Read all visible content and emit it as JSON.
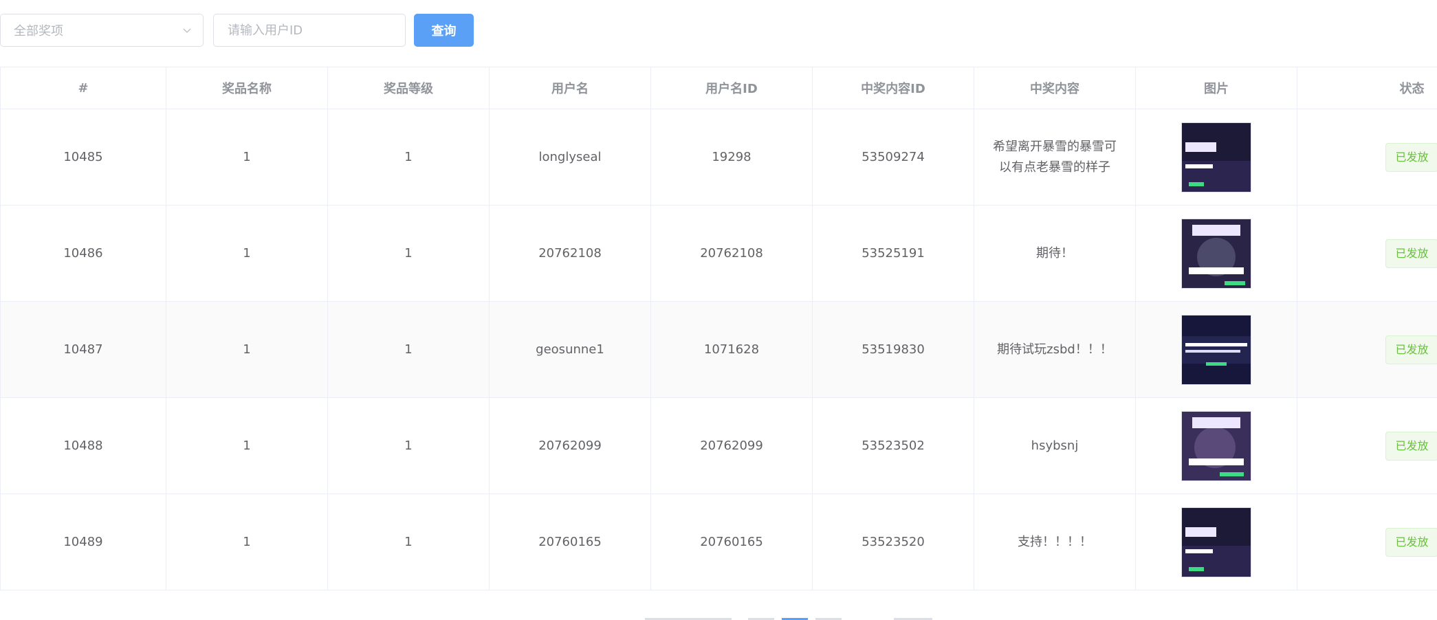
{
  "filters": {
    "prize_select": "全部奖项",
    "user_id_placeholder": "请输入用户ID",
    "query_label": "查询"
  },
  "table": {
    "headers": [
      "#",
      "奖品名称",
      "奖品等级",
      "用户名",
      "用户名ID",
      "中奖内容ID",
      "中奖内容",
      "图片",
      "状态"
    ],
    "rows": [
      {
        "id": "10485",
        "prize_name": "1",
        "prize_level": "1",
        "username": "longlyseal",
        "user_id": "19298",
        "content_id": "53509274",
        "content": "希望离开暴雪的暴雪可以有点老暴雪的样子",
        "status": "已发放"
      },
      {
        "id": "10486",
        "prize_name": "1",
        "prize_level": "1",
        "username": "20762108",
        "user_id": "20762108",
        "content_id": "53525191",
        "content": "期待！",
        "status": "已发放"
      },
      {
        "id": "10487",
        "prize_name": "1",
        "prize_level": "1",
        "username": "geosunne1",
        "user_id": "1071628",
        "content_id": "53519830",
        "content": "期待试玩zsbd！！！",
        "status": "已发放"
      },
      {
        "id": "10488",
        "prize_name": "1",
        "prize_level": "1",
        "username": "20762099",
        "user_id": "20762099",
        "content_id": "53523502",
        "content": "hsybsnj",
        "status": "已发放"
      },
      {
        "id": "10489",
        "prize_name": "1",
        "prize_level": "1",
        "username": "20760165",
        "user_id": "20760165",
        "content_id": "53523520",
        "content": "支持！！！！",
        "status": "已发放"
      }
    ]
  },
  "colors": {
    "primary": "#5aa0f7",
    "success": "#67c23a",
    "border": "#ebeef5",
    "header_text": "#909399"
  },
  "icons": {
    "select_arrow": "chevron-down-icon"
  }
}
